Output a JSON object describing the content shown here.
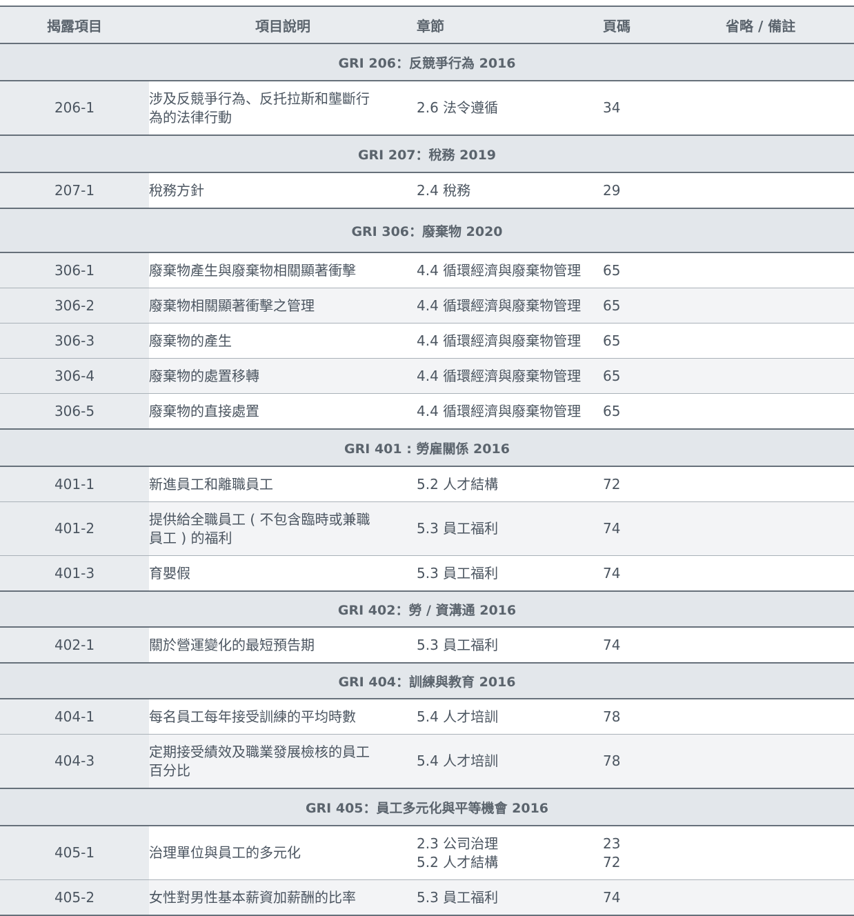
{
  "headers": {
    "code": "揭露項目",
    "desc": "項目說明",
    "chapter": "章節",
    "page": "頁碼",
    "note": "省略 / 備註"
  },
  "sections": [
    {
      "title": "GRI 206：反競爭行為 2016",
      "rows": [
        {
          "code": "206-1",
          "desc": [
            "涉及反競爭行為、反托拉斯和壟斷行",
            "為的法律行動"
          ],
          "chapter": [
            "2.6 法令遵循"
          ],
          "page": [
            "34"
          ]
        }
      ]
    },
    {
      "title": "GRI 207：稅務 2019",
      "rows": [
        {
          "code": "207-1",
          "desc": [
            "稅務方針"
          ],
          "chapter": [
            "2.4 稅務"
          ],
          "page": [
            "29"
          ]
        }
      ]
    },
    {
      "title": "GRI 306：廢棄物 2020",
      "rows": [
        {
          "code": "306-1",
          "desc": [
            "廢棄物產生與廢棄物相關顯著衝擊"
          ],
          "chapter": [
            "4.4 循環經濟與廢棄物管理"
          ],
          "page": [
            "65"
          ]
        },
        {
          "code": "306-2",
          "desc": [
            "廢棄物相關顯著衝擊之管理"
          ],
          "chapter": [
            "4.4 循環經濟與廢棄物管理"
          ],
          "page": [
            "65"
          ]
        },
        {
          "code": "306-3",
          "desc": [
            "廢棄物的產生"
          ],
          "chapter": [
            "4.4 循環經濟與廢棄物管理"
          ],
          "page": [
            "65"
          ]
        },
        {
          "code": "306-4",
          "desc": [
            "廢棄物的處置移轉"
          ],
          "chapter": [
            "4.4 循環經濟與廢棄物管理"
          ],
          "page": [
            "65"
          ]
        },
        {
          "code": "306-5",
          "desc": [
            "廢棄物的直接處置"
          ],
          "chapter": [
            "4.4 循環經濟與廢棄物管理"
          ],
          "page": [
            "65"
          ]
        }
      ]
    },
    {
      "title": "GRI 401 : 勞雇關係 2016",
      "rows": [
        {
          "code": "401-1",
          "desc": [
            "新進員工和離職員工"
          ],
          "chapter": [
            "5.2 人才結構"
          ],
          "page": [
            "72"
          ]
        },
        {
          "code": "401-2",
          "desc": [
            "提供給全職員工 ( 不包含臨時或兼職",
            "員工 ) 的福利"
          ],
          "chapter": [
            "5.3 員工福利"
          ],
          "page": [
            "74"
          ]
        },
        {
          "code": "401-3",
          "desc": [
            "育嬰假"
          ],
          "chapter": [
            "5.3 員工福利"
          ],
          "page": [
            "74"
          ]
        }
      ]
    },
    {
      "title": "GRI 402：勞 / 資溝通 2016",
      "rows": [
        {
          "code": "402-1",
          "desc": [
            "關於營運變化的最短預告期"
          ],
          "chapter": [
            "5.3 員工福利"
          ],
          "page": [
            "74"
          ]
        }
      ]
    },
    {
      "title": "GRI 404：訓練與教育 2016",
      "rows": [
        {
          "code": "404-1",
          "desc": [
            "每名員工每年接受訓練的平均時數"
          ],
          "chapter": [
            "5.4 人才培訓"
          ],
          "page": [
            "78"
          ]
        },
        {
          "code": "404-3",
          "desc": [
            "定期接受績效及職業發展檢核的員工",
            "百分比"
          ],
          "chapter": [
            "5.4 人才培訓"
          ],
          "page": [
            "78"
          ]
        }
      ]
    },
    {
      "title": "GRI 405：員工多元化與平等機會 2016",
      "rows": [
        {
          "code": "405-1",
          "desc": [
            "治理單位與員工的多元化"
          ],
          "chapter": [
            "2.3 公司治理",
            "5.2 人才結構"
          ],
          "page": [
            "23",
            "72"
          ]
        },
        {
          "code": "405-2",
          "desc": [
            "女性對男性基本薪資加薪酬的比率"
          ],
          "chapter": [
            "5.3 員工福利"
          ],
          "page": [
            "74"
          ]
        }
      ]
    }
  ]
}
